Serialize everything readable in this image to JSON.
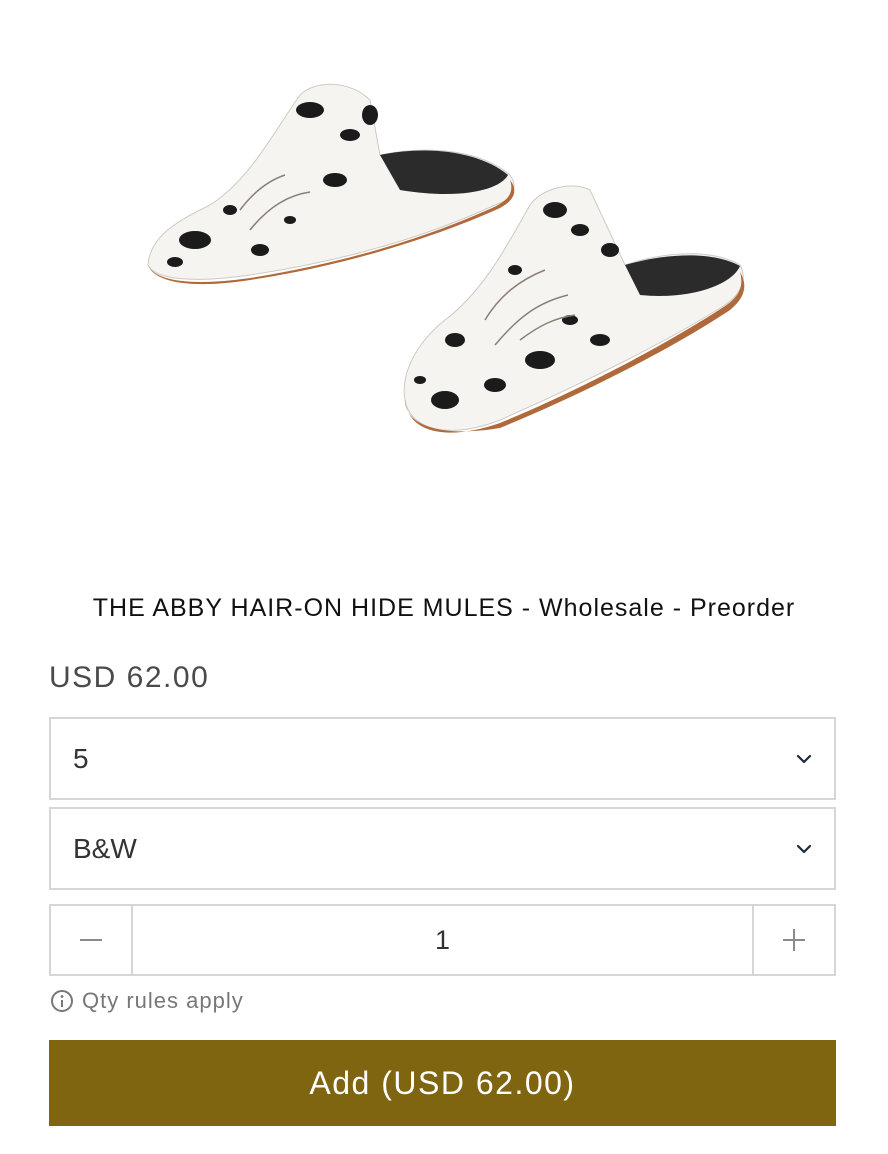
{
  "product": {
    "image_alt": "Hair-on hide mules, black and white",
    "title": "THE ABBY HAIR-ON HIDE MULES - Wholesale - Preorder",
    "price": "USD 62.00"
  },
  "options": {
    "size": {
      "selected": "5",
      "icon": "chevron-down-icon"
    },
    "color": {
      "selected": "B&W",
      "icon": "chevron-down-icon"
    }
  },
  "quantity": {
    "value": "1",
    "minus_icon": "minus-icon",
    "plus_icon": "plus-icon"
  },
  "rules": {
    "icon": "info-icon",
    "text": "Qty rules apply"
  },
  "cart": {
    "add_label": "Add (USD 62.00)",
    "button_color": "#806511"
  }
}
